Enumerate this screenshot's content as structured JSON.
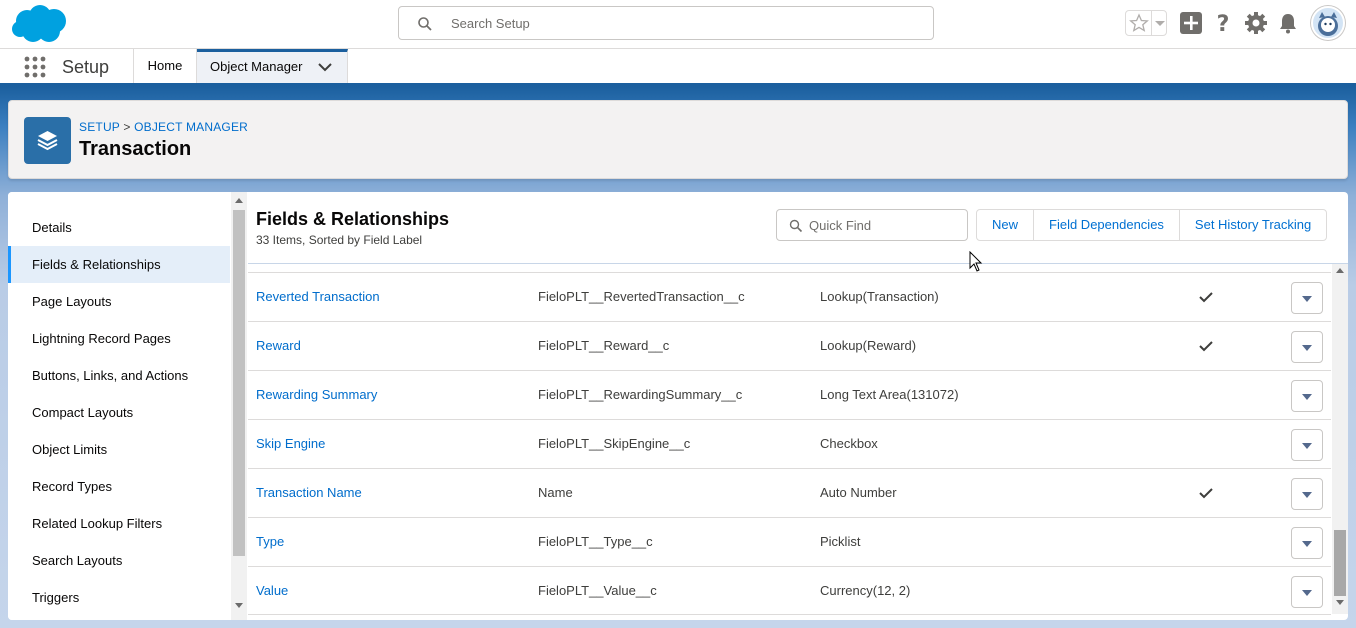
{
  "header": {
    "search_placeholder": "Search Setup",
    "icons": [
      "salesforce-cloud-logo",
      "search-icon",
      "star-icon",
      "chevron-down-icon",
      "add-icon",
      "help-icon",
      "gear-icon",
      "notification-bell-icon",
      "avatar"
    ]
  },
  "context_bar": {
    "app_name": "Setup",
    "tabs": [
      {
        "label": "Home",
        "active": false
      },
      {
        "label": "Object Manager",
        "active": true
      }
    ]
  },
  "page_header": {
    "breadcrumb": [
      "SETUP",
      "OBJECT MANAGER"
    ],
    "breadcrumb_separator": ">",
    "title": "Transaction"
  },
  "sidebar": {
    "items": [
      {
        "label": "Details",
        "active": false
      },
      {
        "label": "Fields & Relationships",
        "active": true
      },
      {
        "label": "Page Layouts",
        "active": false
      },
      {
        "label": "Lightning Record Pages",
        "active": false
      },
      {
        "label": "Buttons, Links, and Actions",
        "active": false
      },
      {
        "label": "Compact Layouts",
        "active": false
      },
      {
        "label": "Object Limits",
        "active": false
      },
      {
        "label": "Record Types",
        "active": false
      },
      {
        "label": "Related Lookup Filters",
        "active": false
      },
      {
        "label": "Search Layouts",
        "active": false
      },
      {
        "label": "Triggers",
        "active": false
      }
    ]
  },
  "main": {
    "title": "Fields & Relationships",
    "subtitle": "33 Items, Sorted by Field Label",
    "quick_find_placeholder": "Quick Find",
    "buttons": {
      "new": "New",
      "field_dependencies": "Field Dependencies",
      "set_history_tracking": "Set History Tracking"
    },
    "rows": [
      {
        "label": "Reverted Transaction",
        "api": "FieloPLT__RevertedTransaction__c",
        "type": "Lookup(Transaction)",
        "indexed": true
      },
      {
        "label": "Reward",
        "api": "FieloPLT__Reward__c",
        "type": "Lookup(Reward)",
        "indexed": true
      },
      {
        "label": "Rewarding Summary",
        "api": "FieloPLT__RewardingSummary__c",
        "type": "Long Text Area(131072)",
        "indexed": false
      },
      {
        "label": "Skip Engine",
        "api": "FieloPLT__SkipEngine__c",
        "type": "Checkbox",
        "indexed": false
      },
      {
        "label": "Transaction Name",
        "api": "Name",
        "type": "Auto Number",
        "indexed": true
      },
      {
        "label": "Type",
        "api": "FieloPLT__Type__c",
        "type": "Picklist",
        "indexed": false
      },
      {
        "label": "Value",
        "api": "FieloPLT__Value__c",
        "type": "Currency(12, 2)",
        "indexed": false
      }
    ]
  },
  "colors": {
    "brand": "#1b5f9e",
    "link": "#006dcc",
    "object_icon": "#2a6fa8"
  }
}
